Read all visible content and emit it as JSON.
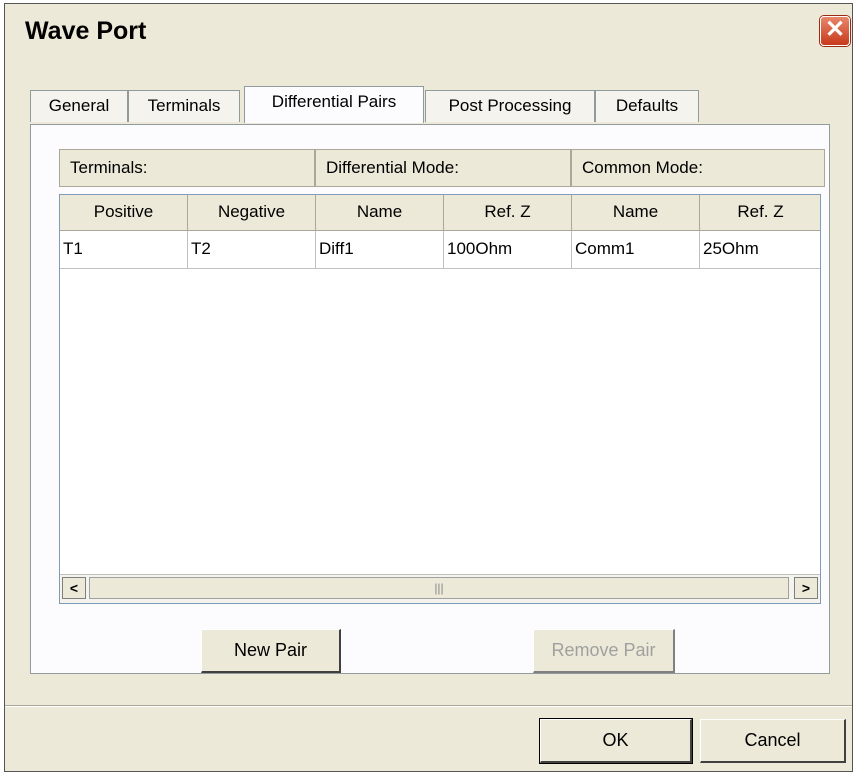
{
  "window": {
    "title": "Wave Port",
    "close_symbol": "✕"
  },
  "tabs": [
    {
      "label": "General",
      "active": false
    },
    {
      "label": "Terminals",
      "active": false
    },
    {
      "label": "Differential Pairs",
      "active": true
    },
    {
      "label": "Post Processing",
      "active": false
    },
    {
      "label": "Defaults",
      "active": false
    }
  ],
  "groups": {
    "terminals": "Terminals:",
    "differential_mode": "Differential Mode:",
    "common_mode": "Common Mode:"
  },
  "table": {
    "columns": [
      "Positive",
      "Negative",
      "Name",
      "Ref. Z",
      "Name",
      "Ref. Z"
    ],
    "rows": [
      [
        "T1",
        "T2",
        "Diff1",
        "100Ohm",
        "Comm1",
        "25Ohm"
      ]
    ]
  },
  "scrollbar": {
    "left_arrow": "<",
    "right_arrow": ">",
    "grip": "|||"
  },
  "buttons": {
    "new_pair": "New Pair",
    "remove_pair": "Remove Pair",
    "ok": "OK",
    "cancel": "Cancel"
  }
}
